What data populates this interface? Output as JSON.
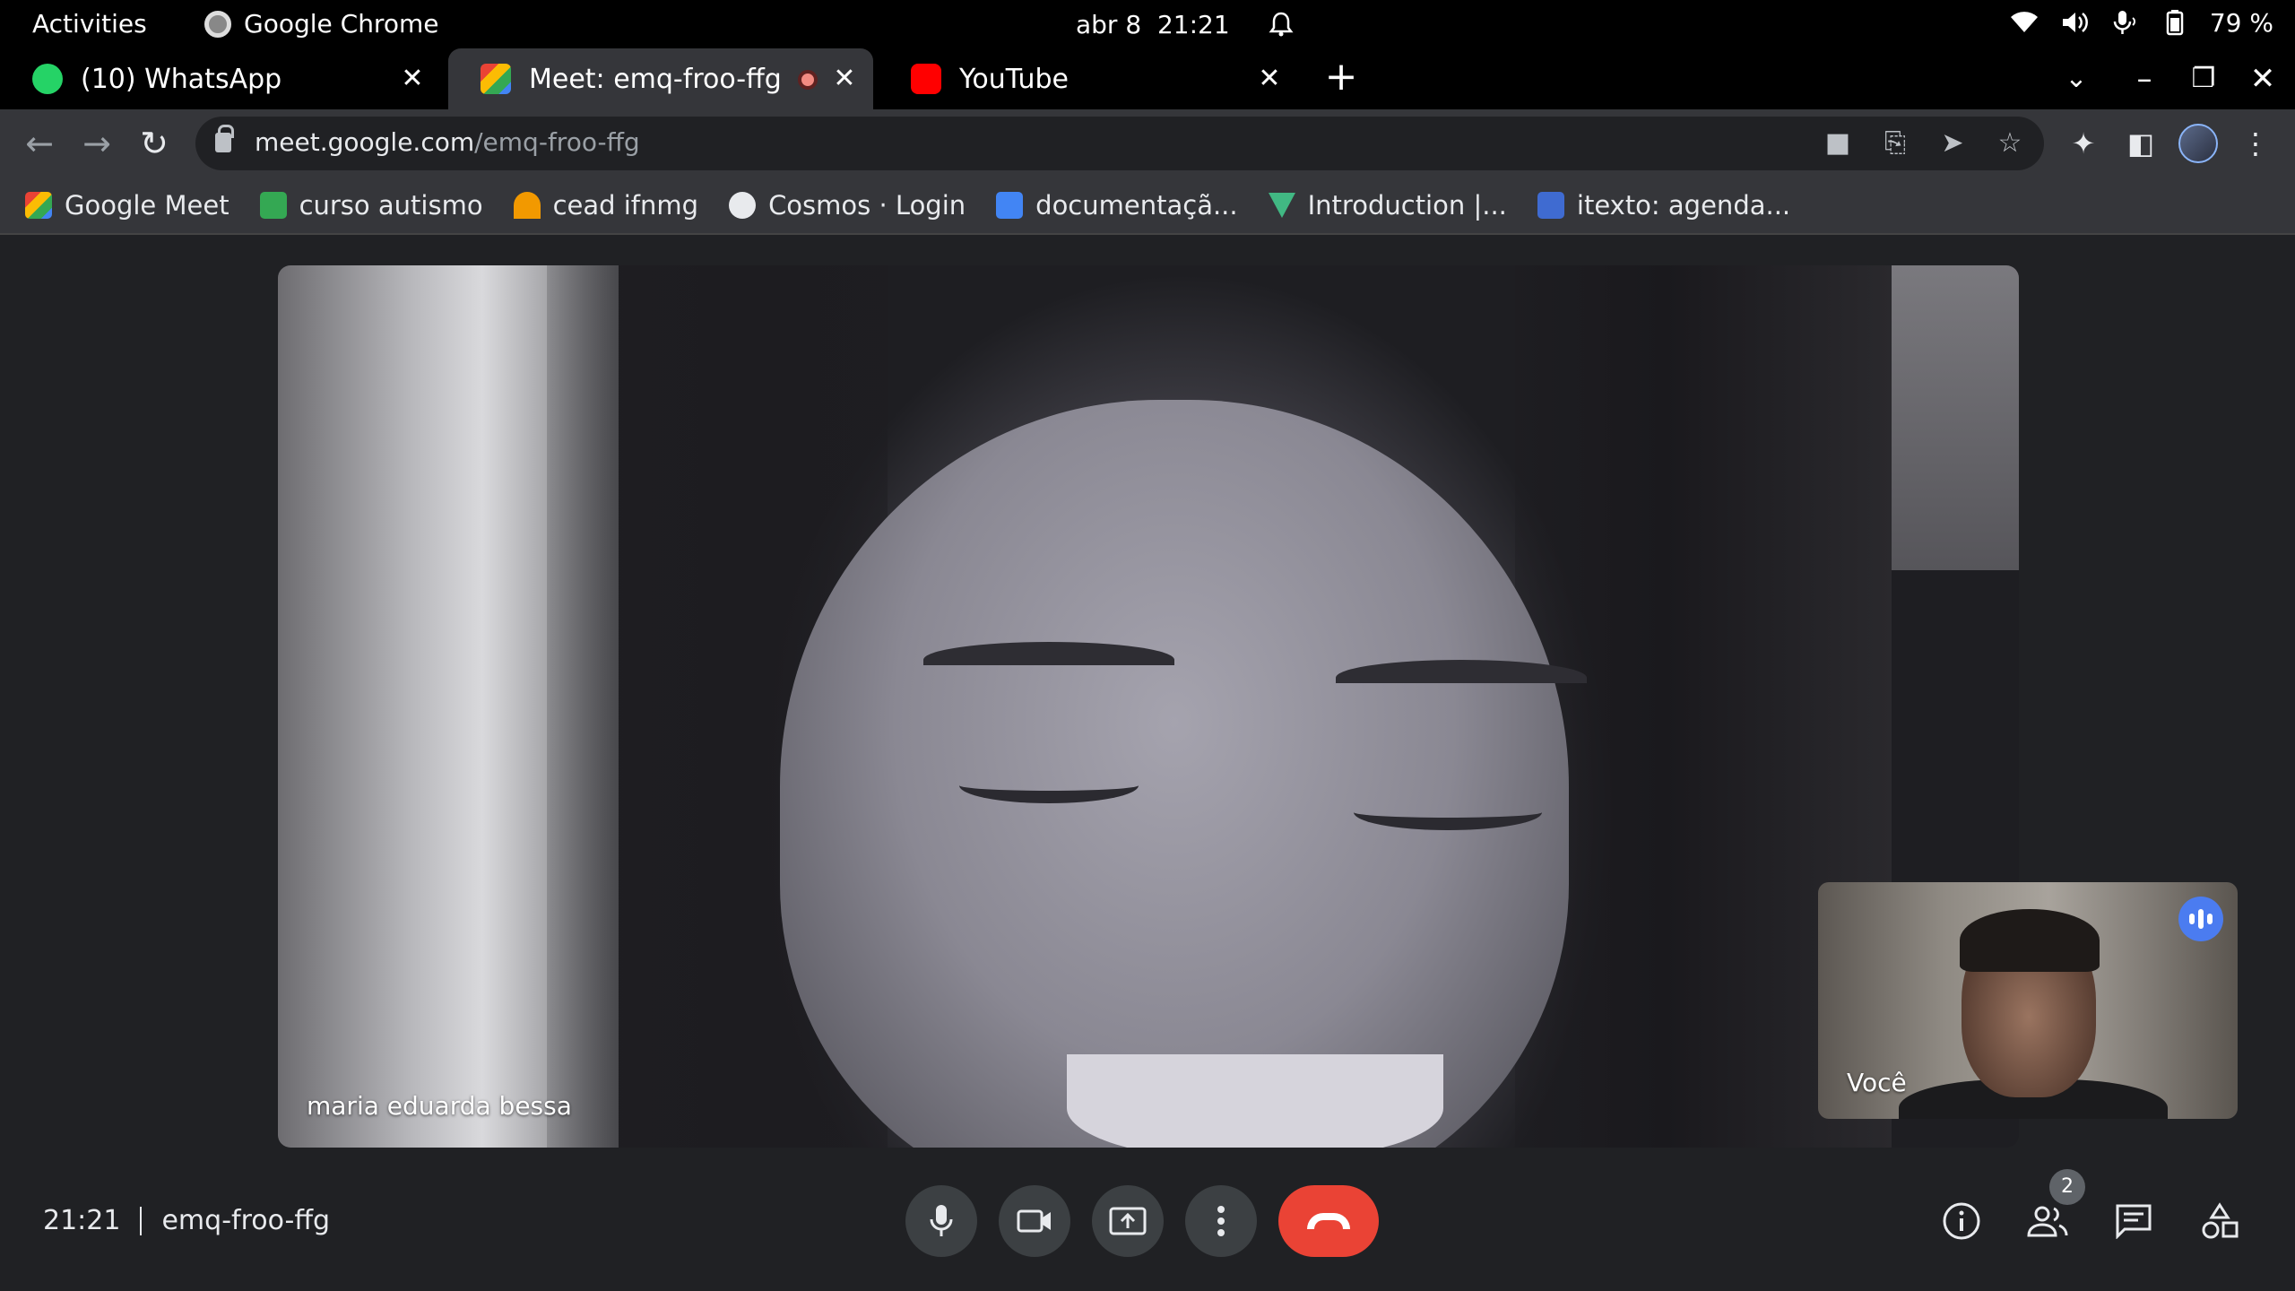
{
  "gnome": {
    "activities": "Activities",
    "app_name": "Google Chrome",
    "date": "abr 8",
    "time": "21:21",
    "battery": "79 %"
  },
  "tabs": [
    {
      "label": "(10) WhatsApp",
      "favicon_color": "#25d366",
      "icon": "whatsapp-icon"
    },
    {
      "label": "Meet: emq-froo-ffg",
      "favicon_color": "#00832d",
      "icon": "google-meet-icon"
    },
    {
      "label": "YouTube",
      "favicon_color": "#ff0000",
      "icon": "youtube-icon"
    }
  ],
  "omnibox": {
    "host": "meet.google.com",
    "path": "/emq-froo-ffg"
  },
  "bookmarks": [
    {
      "label": "Google Meet",
      "color": "#00832d"
    },
    {
      "label": "curso autismo",
      "color": "#34a853"
    },
    {
      "label": "cead ifnmg",
      "color": "#f29900"
    },
    {
      "label": "Cosmos · Login",
      "color": "#e8eaed"
    },
    {
      "label": "documentaçã...",
      "color": "#4285f4"
    },
    {
      "label": "Introduction |...",
      "color": "#41b883"
    },
    {
      "label": "itexto: agenda...",
      "color": "#3f6bd1"
    }
  ],
  "meet": {
    "main_participant": "maria eduarda bessa",
    "self_label": "Você",
    "time": "21:21",
    "meeting_code": "emq-froo-ffg",
    "participant_count": "2"
  },
  "colors": {
    "end_call": "#ea4335",
    "speaking": "#4b7cf0",
    "background": "#202124"
  }
}
